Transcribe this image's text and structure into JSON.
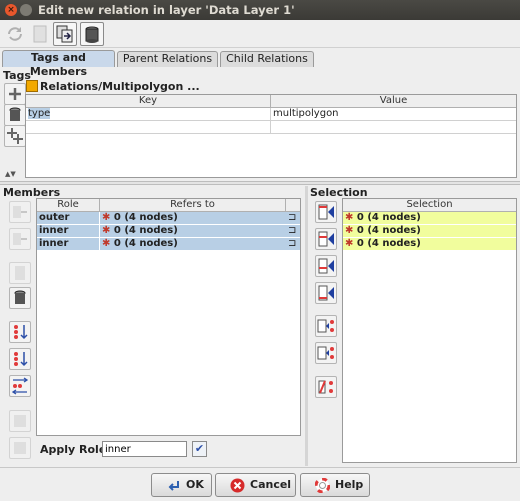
{
  "window": {
    "title": "Edit new relation in layer 'Data Layer 1'"
  },
  "tabs": [
    {
      "label": "Tags and Members",
      "active": true
    },
    {
      "label": "Parent Relations",
      "active": false
    },
    {
      "label": "Child Relations",
      "active": false
    }
  ],
  "tags": {
    "section_label": "Tags",
    "preset_label": "Relations/Multipolygon ...",
    "columns": [
      "Key",
      "Value"
    ],
    "rows": [
      {
        "key": "type",
        "value": "multipolygon"
      }
    ]
  },
  "members": {
    "section_label": "Members",
    "columns": [
      "Role",
      "Refers to"
    ],
    "rows": [
      {
        "role": "outer",
        "refers_to": "0 (4 nodes)"
      },
      {
        "role": "inner",
        "refers_to": "0 (4 nodes)"
      },
      {
        "role": "inner",
        "refers_to": "0 (4 nodes)"
      }
    ],
    "apply_role_label": "Apply Role:",
    "apply_role_value": "inner"
  },
  "selection": {
    "section_label": "Selection",
    "column": "Selection",
    "rows": [
      "0 (4 nodes)",
      "0 (4 nodes)",
      "0 (4 nodes)"
    ]
  },
  "buttons": {
    "ok": "OK",
    "cancel": "Cancel",
    "help": "Help"
  },
  "colors": {
    "selected_row": "#b8cfe5",
    "selection_row": "#f1fd9d",
    "active_tab": "#c9d8ea"
  }
}
